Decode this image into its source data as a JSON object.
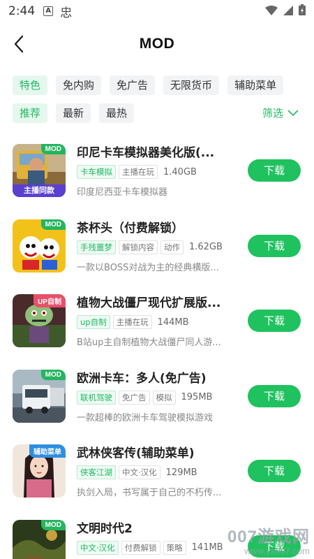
{
  "status": {
    "time": "2:44",
    "icon_a": "A",
    "icon_b": "忠"
  },
  "header": {
    "title": "MOD"
  },
  "filters_row1": [
    "特色",
    "免内购",
    "免广告",
    "无限货币",
    "辅助菜单"
  ],
  "filters_row2": [
    "推荐",
    "最新",
    "最热"
  ],
  "filter_button": "筛选",
  "colors": {
    "accent": "#20c15f",
    "accent_text": "#20b864"
  },
  "apps": [
    {
      "name": "印尼卡车模拟器美化版(...",
      "badge": "MOD",
      "icon_caption": "主播同款",
      "tags": [
        "卡车模拟",
        "主播在玩"
      ],
      "tag_styles": [
        "green",
        "gray"
      ],
      "size": "1.40GB",
      "desc": "印度尼西亚卡车模拟器",
      "button": "下载"
    },
    {
      "name": "茶杯头（付费解锁）",
      "badge": "MOD",
      "tags": [
        "手残噩梦",
        "解锁内容",
        "动作"
      ],
      "tag_styles": [
        "green",
        "gray",
        "gray"
      ],
      "size": "1.62GB",
      "desc": "一款以BOSS对战为主的经典横版...",
      "button": "下载"
    },
    {
      "name": "植物大战僵尸现代扩展版...",
      "badge": "UP自制",
      "tags": [
        "up自制",
        "主播在玩"
      ],
      "tag_styles": [
        "green",
        "gray"
      ],
      "size": "144MB",
      "desc": "B站up主自制植物大战僵尸同人游...",
      "button": "下载"
    },
    {
      "name": "欧洲卡车：多人(免广告)",
      "badge": "MOD",
      "tags": [
        "联机驾驶",
        "免广告",
        "模拟"
      ],
      "tag_styles": [
        "green",
        "gray",
        "gray"
      ],
      "size": "195MB",
      "desc": "一款超棒的欧洲卡车驾驶模拟游戏",
      "button": "下载"
    },
    {
      "name": "武林侠客传(辅助菜单)",
      "badge": "辅助菜单",
      "tags": [
        "侠客江湖",
        "中文·汉化"
      ],
      "tag_styles": [
        "green",
        "gray"
      ],
      "size": "129MB",
      "desc": "执剑入局，书写属于自己的不朽传...",
      "button": "下载"
    },
    {
      "name": "文明时代2",
      "badge": "MOD",
      "tags": [
        "中文·汉化",
        "付费解锁",
        "策略"
      ],
      "tag_styles": [
        "green",
        "gray",
        "gray"
      ],
      "size": "141MB",
      "desc": "",
      "button": "下载"
    }
  ],
  "watermark": {
    "top": "007游戏网",
    "bottom": "www.yx007.com"
  }
}
